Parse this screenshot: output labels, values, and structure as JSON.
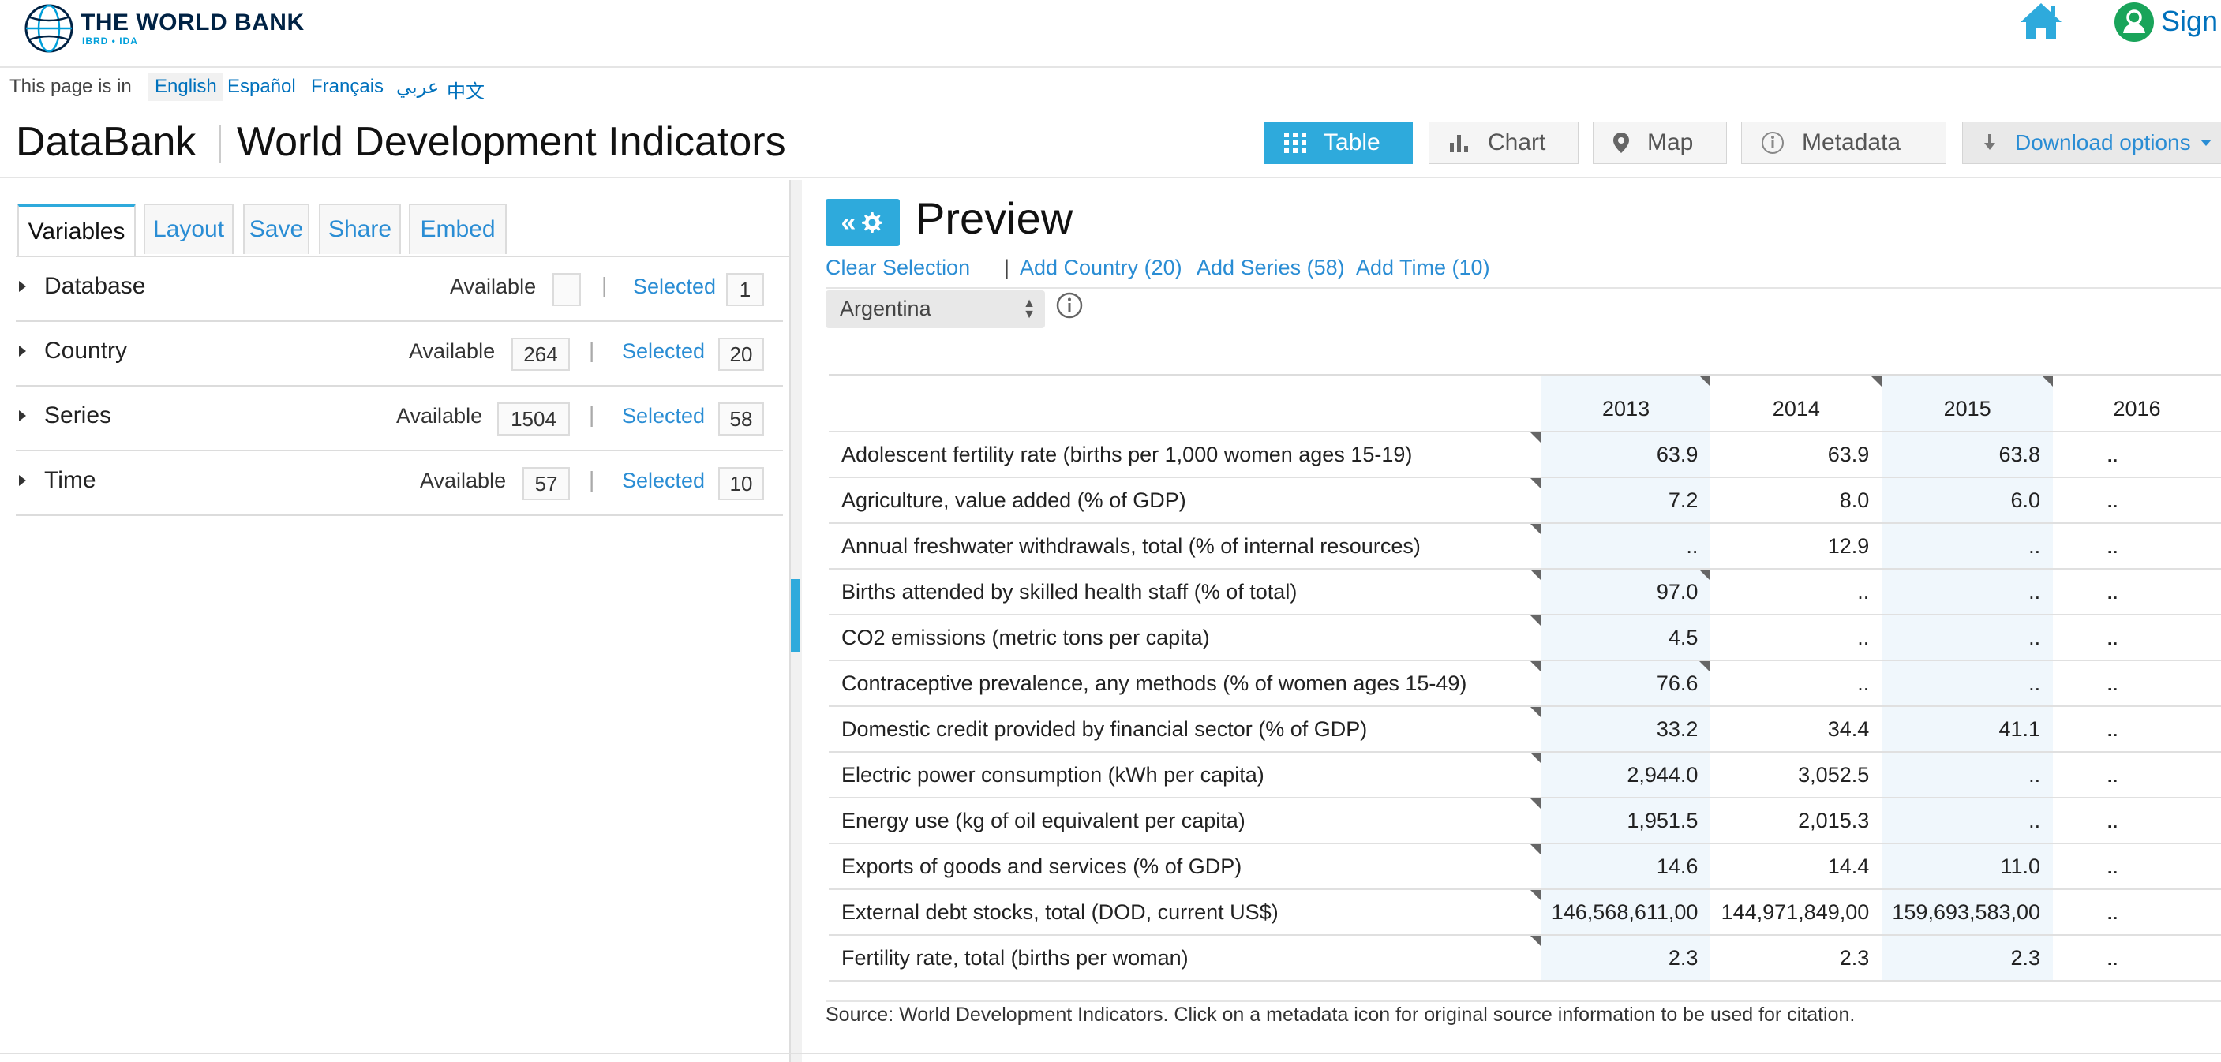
{
  "header": {
    "logo_title": "THE WORLD BANK",
    "logo_subtitle": "IBRD • IDA",
    "sign_in": "Sign I"
  },
  "language_bar": {
    "prefix": "This page is in",
    "languages": [
      "English",
      "Español",
      "Français",
      "عربي",
      "中文"
    ],
    "active": "English"
  },
  "title_bar": {
    "app_name": "DataBank",
    "database_name": "World Development Indicators",
    "views": [
      "Table",
      "Chart",
      "Map",
      "Metadata"
    ],
    "active_view": "Table",
    "download": "Download options"
  },
  "left_panel": {
    "tabs": [
      "Variables",
      "Layout",
      "Save",
      "Share",
      "Embed"
    ],
    "active_tab": "Variables",
    "available_label": "Available",
    "selected_label": "Selected",
    "variables": [
      {
        "name": "Database",
        "available": "",
        "selected": "1"
      },
      {
        "name": "Country",
        "available": "264",
        "selected": "20"
      },
      {
        "name": "Series",
        "available": "1504",
        "selected": "58"
      },
      {
        "name": "Time",
        "available": "57",
        "selected": "10"
      }
    ]
  },
  "preview": {
    "title": "Preview",
    "toggle_label": "«",
    "actions": {
      "clear": "Clear Selection",
      "separator": "|",
      "add_country": "Add Country (20)",
      "add_series": "Add Series (58)",
      "add_time": "Add Time (10)"
    },
    "country_select": "Argentina",
    "table": {
      "years": [
        "2013",
        "2014",
        "2015",
        "2016"
      ],
      "rows": [
        {
          "series": "Adolescent fertility rate (births per 1,000 women ages 15-19)",
          "values": [
            "63.9",
            "63.9",
            "63.8",
            ".."
          ]
        },
        {
          "series": "Agriculture, value added (% of GDP)",
          "values": [
            "7.2",
            "8.0",
            "6.0",
            ".."
          ]
        },
        {
          "series": "Annual freshwater withdrawals, total (% of internal resources)",
          "values": [
            "..",
            "12.9",
            "..",
            ".."
          ]
        },
        {
          "series": "Births attended by skilled health staff (% of total)",
          "values": [
            "97.0",
            "..",
            "..",
            ".."
          ]
        },
        {
          "series": "CO2 emissions (metric tons per capita)",
          "values": [
            "4.5",
            "..",
            "..",
            ".."
          ]
        },
        {
          "series": "Contraceptive prevalence, any methods (% of women ages 15-49)",
          "values": [
            "76.6",
            "..",
            "..",
            ".."
          ]
        },
        {
          "series": "Domestic credit provided by financial sector (% of GDP)",
          "values": [
            "33.2",
            "34.4",
            "41.1",
            ".."
          ]
        },
        {
          "series": "Electric power consumption (kWh per capita)",
          "values": [
            "2,944.0",
            "3,052.5",
            "..",
            ".."
          ]
        },
        {
          "series": "Energy use (kg of oil equivalent per capita)",
          "values": [
            "1,951.5",
            "2,015.3",
            "..",
            ".."
          ]
        },
        {
          "series": "Exports of goods and services (% of GDP)",
          "values": [
            "14.6",
            "14.4",
            "11.0",
            ".."
          ]
        },
        {
          "series": "External debt stocks, total (DOD, current US$)",
          "values": [
            "146,568,611,00",
            "144,971,849,00",
            "159,693,583,00",
            ".."
          ]
        },
        {
          "series": "Fertility rate, total (births per woman)",
          "values": [
            "2.3",
            "2.3",
            "2.3",
            ".."
          ]
        }
      ]
    },
    "source_note": "Source: World Development Indicators. Click on a metadata icon for original source information to be used for citation."
  },
  "colors": {
    "accent": "#2eaadc",
    "link": "#2a8dd4",
    "brand_navy": "#002244",
    "user_green": "#19a45a"
  }
}
